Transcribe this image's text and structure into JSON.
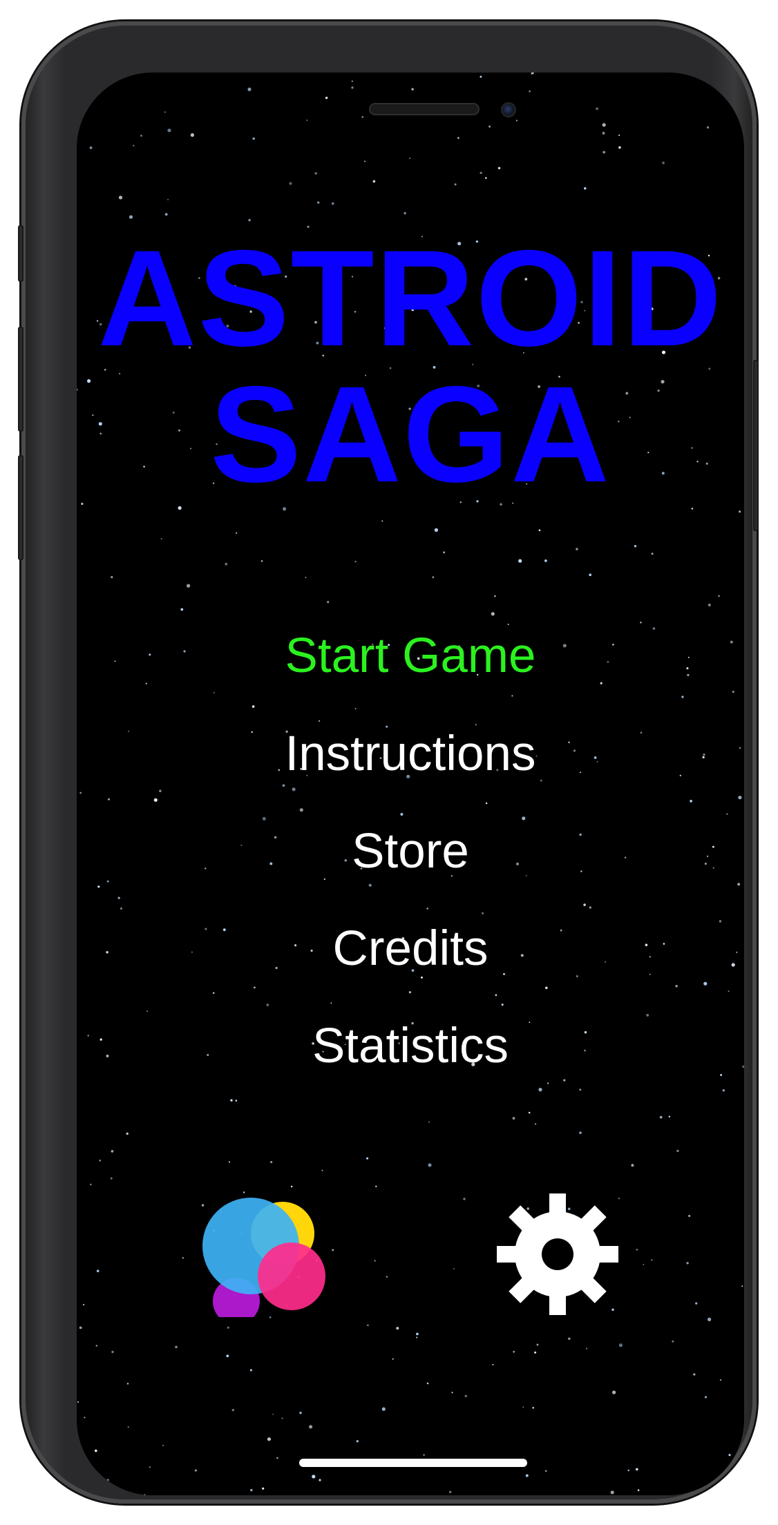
{
  "title": {
    "line1": "ASTROID",
    "line2": "SAGA"
  },
  "menu": {
    "items": [
      {
        "label": "Start Game",
        "selected": true
      },
      {
        "label": "Instructions",
        "selected": false
      },
      {
        "label": "Store",
        "selected": false
      },
      {
        "label": "Credits",
        "selected": false
      },
      {
        "label": "Statistics",
        "selected": false
      }
    ]
  },
  "icons": {
    "game_center": "game-center-icon",
    "settings": "gear-icon"
  },
  "colors": {
    "background": "#000000",
    "title": "#0a00ff",
    "menu_selected": "#2bf21f",
    "menu_default": "#ffffff",
    "gear": "#ffffff"
  }
}
